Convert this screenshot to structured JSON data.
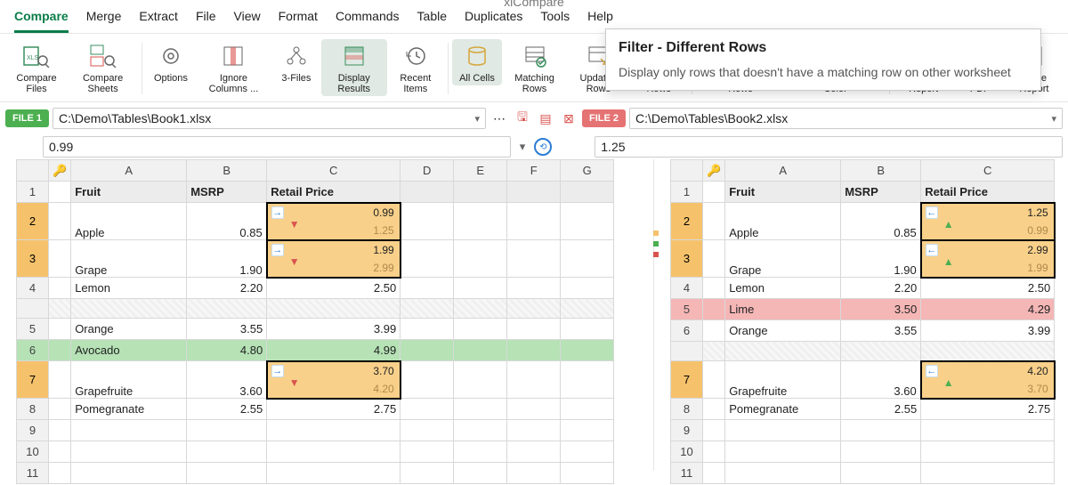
{
  "app_title": "xlCompare",
  "menu": {
    "items": [
      "Compare",
      "Merge",
      "Extract",
      "File",
      "View",
      "Format",
      "Commands",
      "Table",
      "Duplicates",
      "Tools",
      "Help"
    ],
    "active": "Compare"
  },
  "ribbon": {
    "compare_files": "Compare Files",
    "compare_sheets": "Compare Sheets",
    "options": "Options",
    "ignore_columns": "Ignore Columns ...",
    "three_files": "3-Files",
    "display_results": "Display Results",
    "recent_items": "Recent Items",
    "all_cells": "All Cells",
    "matching_rows": "Matching Rows",
    "updated_rows": "Updated Rows",
    "unique_rows": "Unique Rows",
    "remove_hidden": "Remove Hidden Rows",
    "mark_changes": "Mark Changes with Color",
    "create_report": "Create Report",
    "export_pdf": "Export PDF",
    "close_report": "Close Report"
  },
  "tooltip": {
    "title": "Filter - Different Rows",
    "desc": "Display only rows that doesn't have a matching row on other worksheet"
  },
  "file1": {
    "tag": "FILE 1",
    "path": "C:\\Demo\\Tables\\Book1.xlsx",
    "value": "0.99"
  },
  "file2": {
    "tag": "FILE 2",
    "path": "C:\\Demo\\Tables\\Book2.xlsx",
    "value": "1.25"
  },
  "columns": [
    "A",
    "B",
    "C",
    "D",
    "E",
    "F",
    "G"
  ],
  "columns_right": [
    "A",
    "B",
    "C"
  ],
  "headers": {
    "fruit": "Fruit",
    "msrp": "MSRP",
    "retail": "Retail Price"
  },
  "left": {
    "rows": [
      {
        "n": "1",
        "kind": "header"
      },
      {
        "n": "2",
        "kind": "diff",
        "fruit": "Apple",
        "msrp": "0.85",
        "v1": "0.99",
        "v2": "1.25",
        "dir": "down"
      },
      {
        "n": "3",
        "kind": "diff",
        "fruit": "Grape",
        "msrp": "1.90",
        "v1": "1.99",
        "v2": "2.99",
        "dir": "down"
      },
      {
        "n": "4",
        "kind": "plain",
        "fruit": "Lemon",
        "msrp": "2.20",
        "retail": "2.50"
      },
      {
        "n": "",
        "kind": "gap"
      },
      {
        "n": "5",
        "kind": "plain",
        "fruit": "Orange",
        "msrp": "3.55",
        "retail": "3.99"
      },
      {
        "n": "6",
        "kind": "added",
        "fruit": "Avocado",
        "msrp": "4.80",
        "retail": "4.99"
      },
      {
        "n": "7",
        "kind": "diff",
        "fruit": "Grapefruite",
        "msrp": "3.60",
        "v1": "3.70",
        "v2": "4.20",
        "dir": "down"
      },
      {
        "n": "8",
        "kind": "plain",
        "fruit": "Pomegranate",
        "msrp": "2.55",
        "retail": "2.75"
      },
      {
        "n": "9",
        "kind": "empty"
      },
      {
        "n": "10",
        "kind": "empty"
      },
      {
        "n": "11",
        "kind": "empty"
      }
    ]
  },
  "right": {
    "rows": [
      {
        "n": "1",
        "kind": "header"
      },
      {
        "n": "2",
        "kind": "diff",
        "fruit": "Apple",
        "msrp": "0.85",
        "v1": "1.25",
        "v2": "0.99",
        "dir": "up"
      },
      {
        "n": "3",
        "kind": "diff",
        "fruit": "Grape",
        "msrp": "1.90",
        "v1": "2.99",
        "v2": "1.99",
        "dir": "up"
      },
      {
        "n": "4",
        "kind": "plain",
        "fruit": "Lemon",
        "msrp": "2.20",
        "retail": "2.50"
      },
      {
        "n": "5",
        "kind": "deleted",
        "fruit": "Lime",
        "msrp": "3.50",
        "retail": "4.29"
      },
      {
        "n": "6",
        "kind": "plain",
        "fruit": "Orange",
        "msrp": "3.55",
        "retail": "3.99"
      },
      {
        "n": "",
        "kind": "gap"
      },
      {
        "n": "7",
        "kind": "diff",
        "fruit": "Grapefruite",
        "msrp": "3.60",
        "v1": "4.20",
        "v2": "3.70",
        "dir": "up"
      },
      {
        "n": "8",
        "kind": "plain",
        "fruit": "Pomegranate",
        "msrp": "2.55",
        "retail": "2.75"
      },
      {
        "n": "9",
        "kind": "empty"
      },
      {
        "n": "10",
        "kind": "empty"
      },
      {
        "n": "11",
        "kind": "empty"
      }
    ]
  },
  "colors": {
    "accent": "#0a7d4a"
  }
}
